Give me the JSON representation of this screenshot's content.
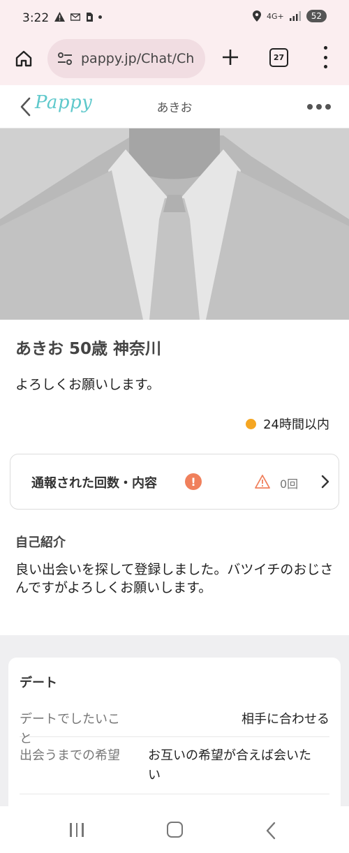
{
  "status_bar": {
    "time": "3:22",
    "left_icons": [
      "warning-icon",
      "mail-icon",
      "sim-icon",
      "dot-icon"
    ],
    "network": "4G+",
    "battery": "52"
  },
  "browser": {
    "url": "pappy.jp/Chat/Ch",
    "tab_count": "27"
  },
  "header": {
    "logo": "Pappy",
    "title": "あきお"
  },
  "profile": {
    "title": "あきお 50歳 神奈川",
    "greeting": "よろしくお願いします。",
    "online_status": "24時間以内",
    "online_color": "#f5a623"
  },
  "report": {
    "label": "通報された回数・内容",
    "alert_mark": "!",
    "count": "0回"
  },
  "intro": {
    "heading": "自己紹介",
    "body": "良い出会いを探して登録しました。バツイチのおじさんですがよろしくお願いします。"
  },
  "date_section": {
    "heading": "デート",
    "rows": [
      {
        "label": "デートでしたいこと",
        "value": "相手に合わせる"
      },
      {
        "label": "出会うまでの希望",
        "value": "お互いの希望が合えば会いたい"
      }
    ]
  },
  "colors": {
    "brand": "#5ec8cb",
    "alert": "#f0805c",
    "browser_bg": "#fbeef0"
  }
}
